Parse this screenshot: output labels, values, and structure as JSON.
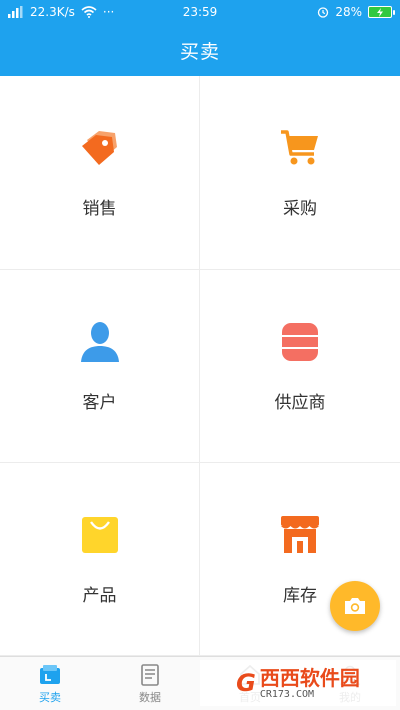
{
  "status_bar": {
    "network_speed": "22.3K/s",
    "dots": "···",
    "time": "23:59",
    "battery_percent": "28%"
  },
  "app_bar": {
    "title": "买卖"
  },
  "grid": {
    "items": [
      {
        "label": "销售",
        "icon": "tag-icon",
        "color": "#f36a1f"
      },
      {
        "label": "采购",
        "icon": "cart-icon",
        "color": "#f7961d"
      },
      {
        "label": "客户",
        "icon": "user-icon",
        "color": "#3d9be9"
      },
      {
        "label": "供应商",
        "icon": "database-icon",
        "color": "#f46f62"
      },
      {
        "label": "产品",
        "icon": "shopping-bag-icon",
        "color": "#ffd52b"
      },
      {
        "label": "库存",
        "icon": "store-icon",
        "color": "#f36a1f"
      }
    ]
  },
  "fab": {
    "icon": "camera-icon",
    "color": "#ffb92a"
  },
  "tab_bar": {
    "tabs": [
      {
        "label": "买卖",
        "icon": "wallet-icon",
        "active": true
      },
      {
        "label": "数据",
        "icon": "document-icon",
        "active": false
      },
      {
        "label": "首页",
        "icon": "home-icon",
        "active": false
      },
      {
        "label": "我的",
        "icon": "person-icon",
        "active": false
      }
    ]
  },
  "watermark": {
    "logo": "G",
    "name": "西西软件园",
    "url": "CR173.COM"
  },
  "colors": {
    "primary": "#1ea2ee",
    "accent": "#ffb92a"
  }
}
